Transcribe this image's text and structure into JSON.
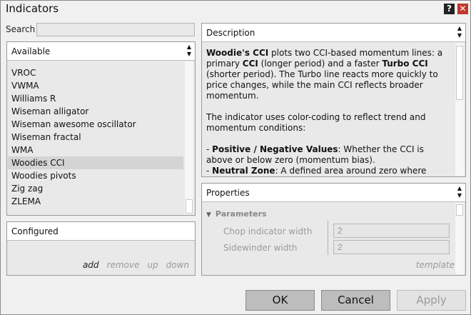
{
  "window": {
    "title": "Indicators",
    "help_glyph": "?",
    "close_glyph": "✕"
  },
  "search": {
    "label": "Search",
    "value": ""
  },
  "available": {
    "header": "Available",
    "items": [
      {
        "label": "VROC",
        "selected": false
      },
      {
        "label": "VWMA",
        "selected": false
      },
      {
        "label": "Williams R",
        "selected": false
      },
      {
        "label": "Wiseman alligator",
        "selected": false
      },
      {
        "label": "Wiseman awesome oscillator",
        "selected": false
      },
      {
        "label": "Wiseman fractal",
        "selected": false
      },
      {
        "label": "WMA",
        "selected": false
      },
      {
        "label": "Woodies CCI",
        "selected": true
      },
      {
        "label": "Woodies pivots",
        "selected": false
      },
      {
        "label": "Zig zag",
        "selected": false
      },
      {
        "label": "ZLEMA",
        "selected": false
      }
    ]
  },
  "configured": {
    "header": "Configured",
    "actions": [
      {
        "label": "add",
        "enabled": true
      },
      {
        "label": "remove",
        "enabled": false
      },
      {
        "label": "up",
        "enabled": false
      },
      {
        "label": "down",
        "enabled": false
      }
    ]
  },
  "description": {
    "header": "Description",
    "p1": [
      {
        "t": "Woodie's CCI",
        "b": true
      },
      {
        "t": " plots two CCI-based momentum lines: a primary ",
        "b": false
      },
      {
        "t": "CCI",
        "b": true
      },
      {
        "t": " (longer period) and a faster ",
        "b": false
      },
      {
        "t": "Turbo CCI",
        "b": true
      },
      {
        "t": " (shorter period). The Turbo line reacts more quickly to price changes, while the main CCI reflects broader momentum.",
        "b": false
      }
    ],
    "p2": "The indicator uses color-coding to reflect trend and momentum conditions:",
    "p3": [
      {
        "t": "- ",
        "b": false
      },
      {
        "t": "Positive / Negative Values",
        "b": true
      },
      {
        "t": ": Whether the CCI is above or below zero (momentum bias).",
        "b": false
      }
    ],
    "p4": [
      {
        "t": "- ",
        "b": false
      },
      {
        "t": "Neutral Zone",
        "b": true
      },
      {
        "t": ": A defined area around zero where momentum is considered relatively balanced.",
        "b": false
      }
    ]
  },
  "properties": {
    "header": "Properties",
    "group": "Parameters",
    "fields": [
      {
        "label": "Chop indicator width",
        "value": "2"
      },
      {
        "label": "Sidewinder width",
        "value": "2"
      }
    ],
    "template_label": "template"
  },
  "buttons": {
    "ok": "OK",
    "cancel": "Cancel",
    "apply": "Apply"
  }
}
